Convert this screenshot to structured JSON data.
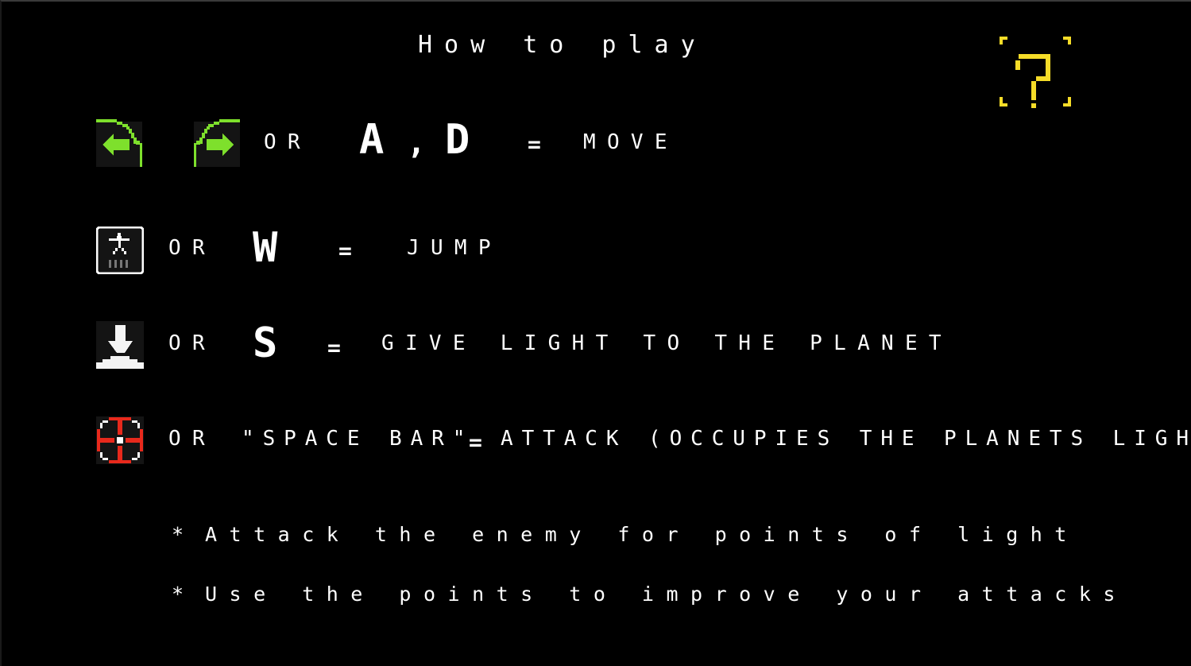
{
  "title": "How to play",
  "help_icon": "question-mark-icon",
  "colors": {
    "background": "#000000",
    "text": "#ffffff",
    "arrow_green": "#7ee02c",
    "help_yellow": "#f5dc28",
    "attack_red": "#e8291c",
    "icon_panel": "#141414"
  },
  "controls": [
    {
      "icons": [
        "left-arrow-button-icon",
        "right-arrow-button-icon"
      ],
      "or": "OR",
      "keys": "A , D",
      "key_a": "A",
      "key_sep": ",",
      "key_d": "D",
      "equals": "=",
      "action": "MOVE"
    },
    {
      "icons": [
        "jump-button-icon"
      ],
      "or": "OR",
      "keys": "W",
      "equals": "=",
      "action": "JUMP"
    },
    {
      "icons": [
        "give-light-down-button-icon"
      ],
      "or": "OR",
      "keys": "S",
      "equals": "=",
      "action": "GIVE LIGHT TO THE PLANET"
    },
    {
      "icons": [
        "attack-crosshair-button-icon"
      ],
      "or": "OR",
      "keys": "\"SPACE BAR\"",
      "equals": "=",
      "action": "ATTACK (OCCUPIES THE PLANETS LIGHT)"
    }
  ],
  "notes": [
    {
      "bullet": "*",
      "text": "Attack the enemy for points of light"
    },
    {
      "bullet": "*",
      "text": "Use the points to improve your attacks"
    }
  ]
}
